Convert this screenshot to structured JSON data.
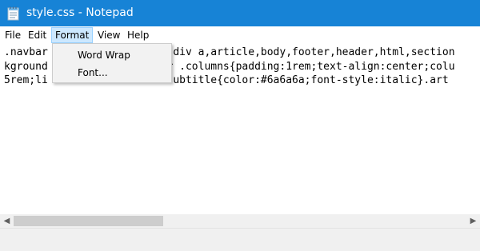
{
  "window": {
    "title": "style.css - Notepad",
    "app_icon": "notepad-icon",
    "titlebar_color": "#1783d6"
  },
  "menubar": {
    "items": [
      {
        "label": "File"
      },
      {
        "label": "Edit"
      },
      {
        "label": "Format",
        "active": true
      },
      {
        "label": "View"
      },
      {
        "label": "Help"
      }
    ]
  },
  "format_menu": {
    "items": [
      {
        "label": "Word Wrap"
      },
      {
        "label": "Font..."
      }
    ]
  },
  "editor": {
    "lines": [
      ".navbar                 ar div a,article,body,footer,header,html,section",
      "kground                 ter .columns{padding:1rem;text-align:center;colu",
      "5rem;li                 e-subtitle{color:#6a6a6a;font-style:italic}.art"
    ]
  },
  "scrollbar": {
    "horizontal_position": 0
  }
}
